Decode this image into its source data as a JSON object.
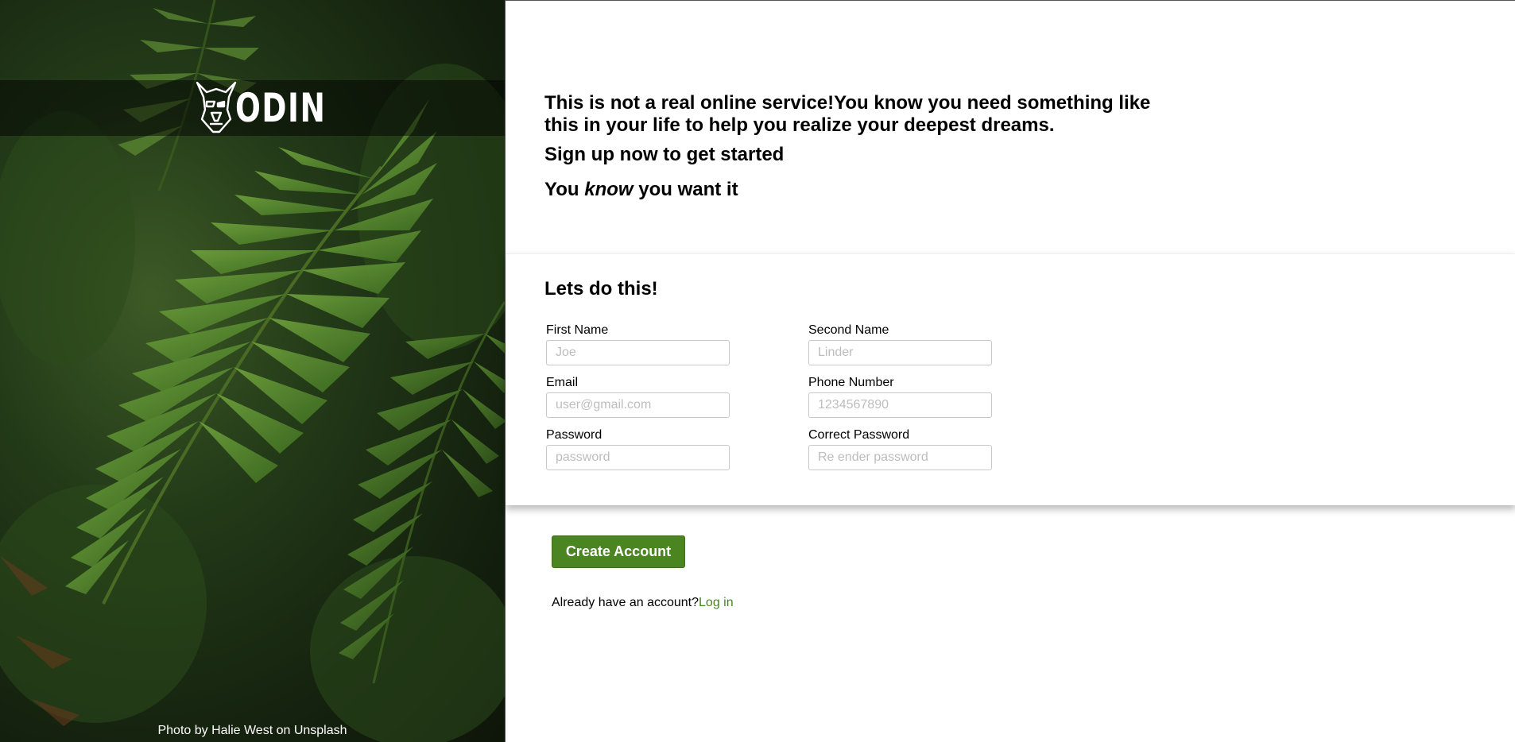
{
  "sidebar": {
    "logo_text": "ODIN",
    "logo_icon": "viking-helmet-icon",
    "photo_credit": "Photo by Halie West on Unsplash"
  },
  "intro": {
    "line1": "This is not a real online service!You know you need something like this in your life to help you realize your deepest dreams.",
    "line2": "Sign up now to get started",
    "line3_before": "You ",
    "line3_em": "know",
    "line3_after": " you want it"
  },
  "form": {
    "title": "Lets do this!",
    "first_name": {
      "label": "First Name",
      "placeholder": "Joe",
      "value": ""
    },
    "second_name": {
      "label": "Second Name",
      "placeholder": "Linder",
      "value": ""
    },
    "email": {
      "label": "Email",
      "placeholder": "user@gmail.com",
      "value": ""
    },
    "phone": {
      "label": "Phone Number",
      "placeholder": "1234567890",
      "value": ""
    },
    "password": {
      "label": "Password",
      "placeholder": "password",
      "value": ""
    },
    "confirm_password": {
      "label": "Correct Password",
      "placeholder": "Re ender password",
      "value": ""
    }
  },
  "actions": {
    "create_label": "Create Account",
    "login_prompt": "Already have an account?",
    "login_link": "Log in"
  },
  "colors": {
    "accent": "#4a8522",
    "text": "#000000",
    "placeholder": "#bdbdbd"
  }
}
